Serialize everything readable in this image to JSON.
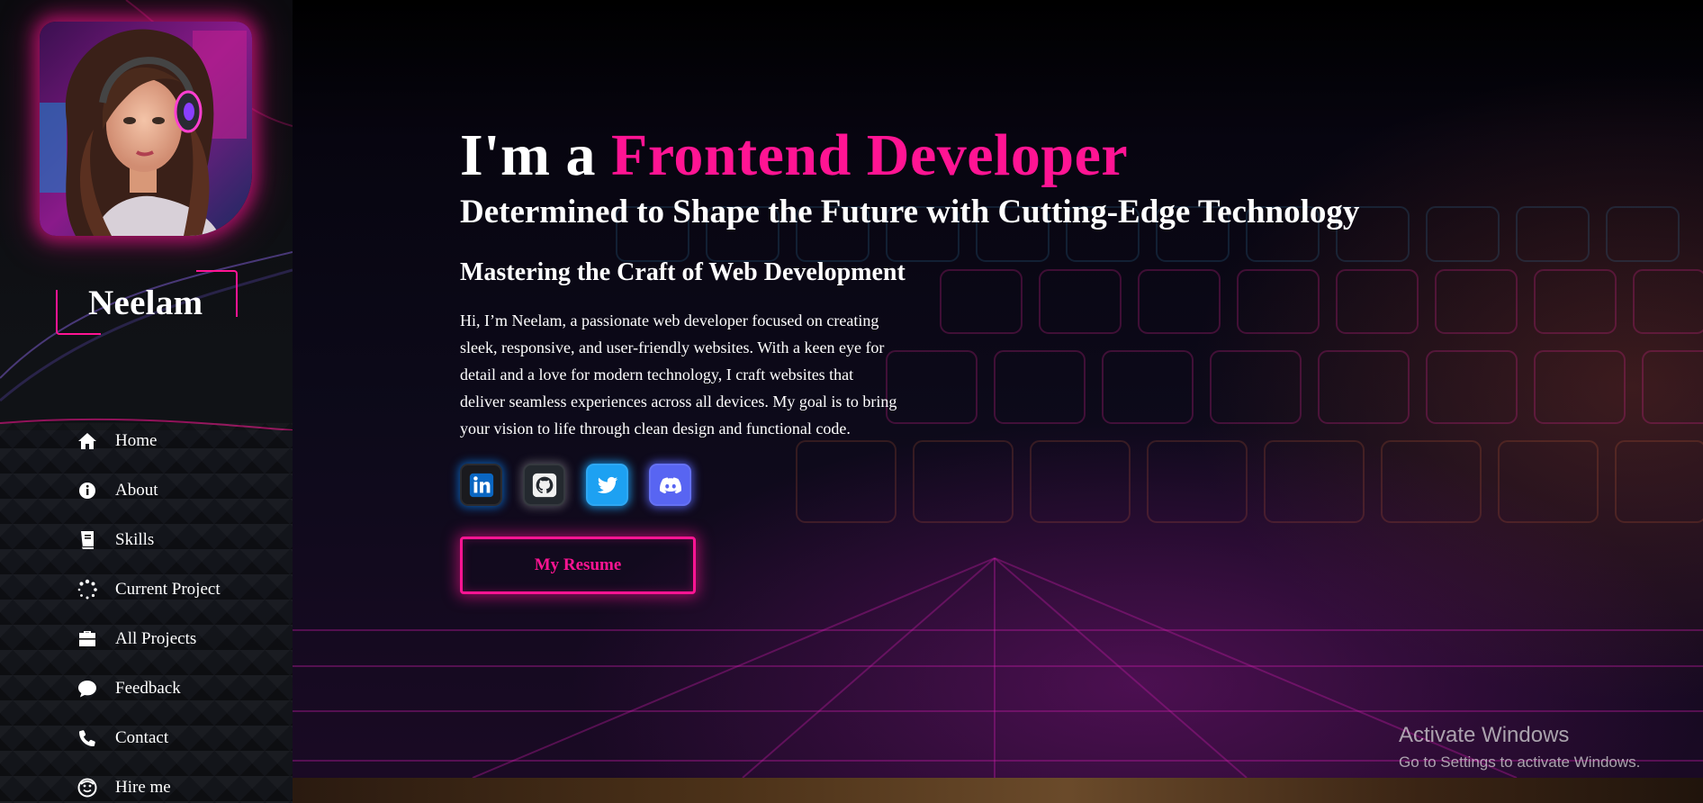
{
  "sidebar": {
    "profile_name": "Neelam",
    "avatar_alt": "",
    "nav": [
      {
        "label": "Home",
        "icon": "home-icon"
      },
      {
        "label": "About",
        "icon": "info-icon"
      },
      {
        "label": "Skills",
        "icon": "book-icon"
      },
      {
        "label": "Current Project",
        "icon": "spinner-icon"
      },
      {
        "label": "All Projects",
        "icon": "briefcase-icon"
      },
      {
        "label": "Feedback",
        "icon": "comment-icon"
      },
      {
        "label": "Contact",
        "icon": "phone-icon"
      },
      {
        "label": "Hire me",
        "icon": "smile-icon"
      }
    ]
  },
  "hero": {
    "title_prefix": "I'm a ",
    "title_highlight": "Frontend Developer",
    "subtitle": "Determined to Shape the Future with Cutting-Edge Technology",
    "tagline": "Mastering the Craft of Web Development",
    "bio": "Hi, I’m Neelam, a passionate web developer focused on creating sleek, responsive, and user-friendly websites. With a keen eye for detail and a love for modern technology, I craft websites that deliver seamless experiences across all devices. My goal is to bring your vision to life through clean design and functional code.",
    "resume_label": "My Resume"
  },
  "socials": [
    {
      "name": "LinkedIn",
      "icon": "linkedin-icon"
    },
    {
      "name": "GitHub",
      "icon": "github-icon"
    },
    {
      "name": "Twitter",
      "icon": "twitter-icon"
    },
    {
      "name": "Discord",
      "icon": "discord-icon"
    }
  ],
  "watermark": {
    "title": "Activate Windows",
    "subtitle": "Go to Settings to activate Windows."
  },
  "colors": {
    "accent": "#ff1493",
    "sidebar_bg": "#0d0f12",
    "linkedin": "#0a66c2",
    "twitter": "#1da1f2",
    "discord": "#5865f2"
  }
}
